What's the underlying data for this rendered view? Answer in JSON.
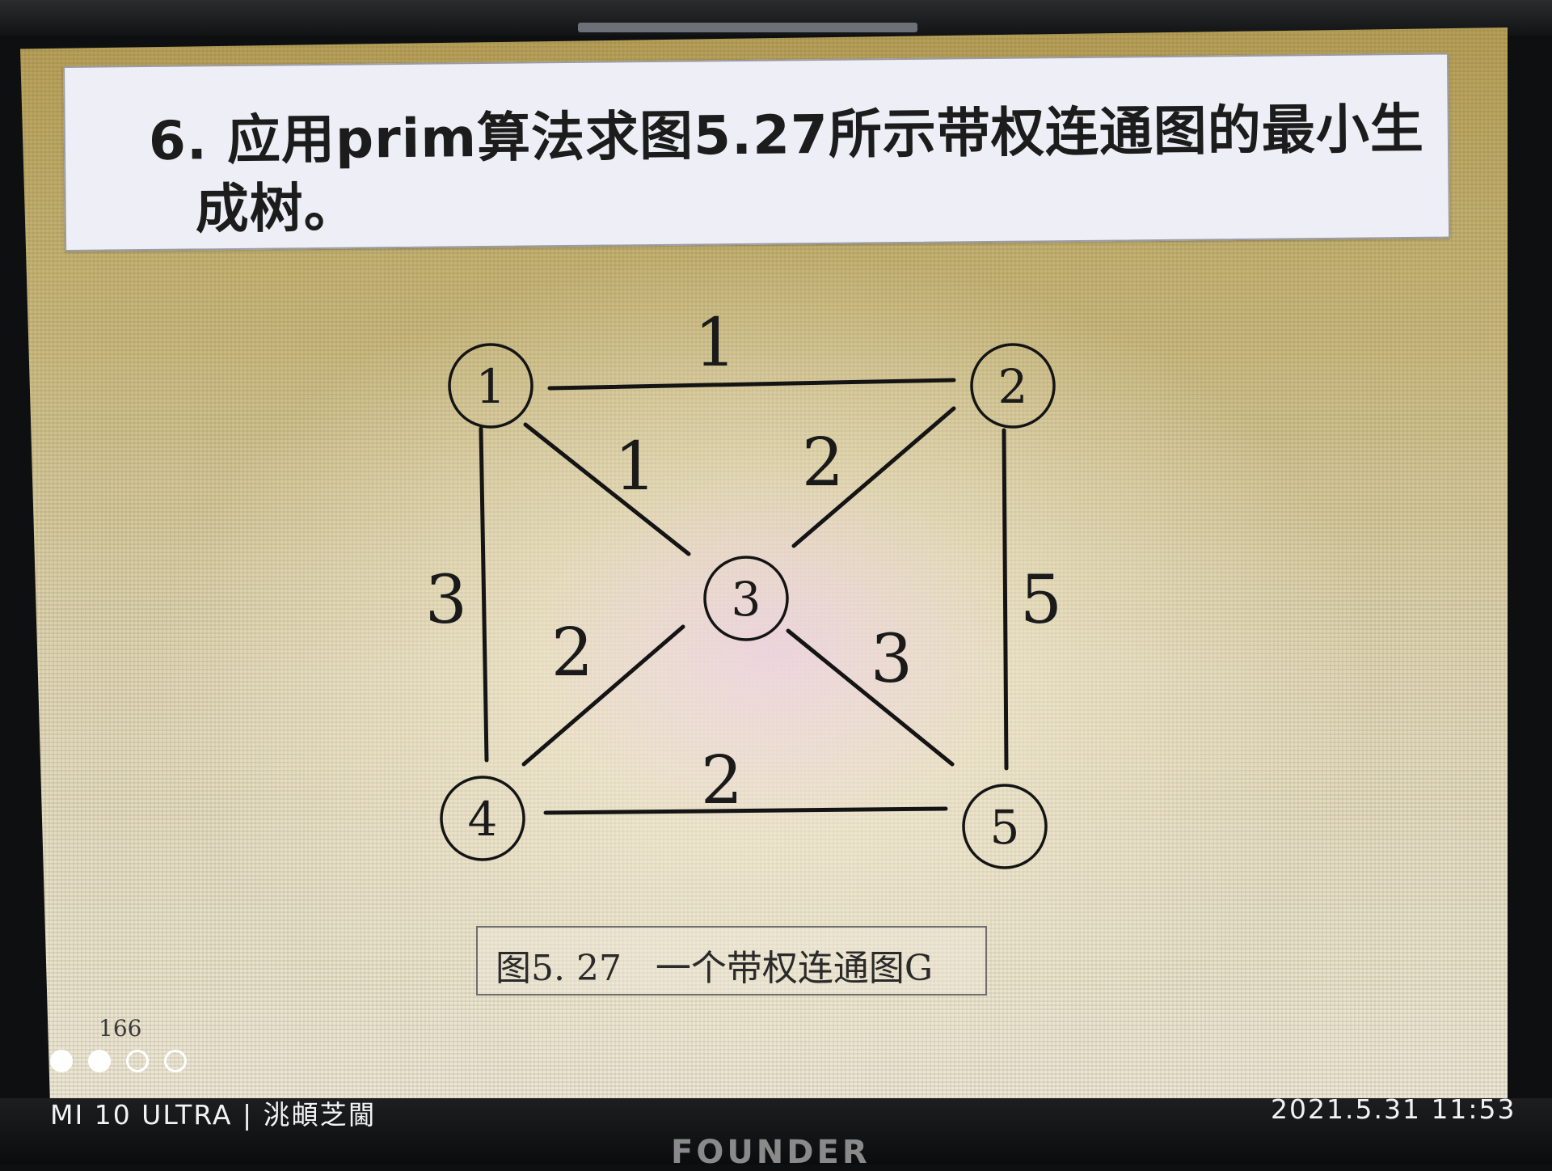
{
  "slide": {
    "title_line_1": "6. 应用prim算法求图5.27所示带权连通图的最小生",
    "title_line_2": "成树。",
    "caption": "图5. 27   一个带权连通图G",
    "page_number": "166"
  },
  "graph": {
    "nodes": [
      {
        "id": "1",
        "label": "①"
      },
      {
        "id": "2",
        "label": "②"
      },
      {
        "id": "3",
        "label": "③"
      },
      {
        "id": "4",
        "label": "④"
      },
      {
        "id": "5",
        "label": "⑤"
      }
    ],
    "edges": [
      {
        "from": "1",
        "to": "2",
        "weight": "1"
      },
      {
        "from": "1",
        "to": "3",
        "weight": "1"
      },
      {
        "from": "2",
        "to": "3",
        "weight": "2"
      },
      {
        "from": "1",
        "to": "4",
        "weight": "3"
      },
      {
        "from": "2",
        "to": "5",
        "weight": "5"
      },
      {
        "from": "3",
        "to": "4",
        "weight": "2"
      },
      {
        "from": "3",
        "to": "5",
        "weight": "3"
      },
      {
        "from": "4",
        "to": "5",
        "weight": "2"
      }
    ]
  },
  "camera_overlay": {
    "watermark_left": "MI 10 ULTRA | 洮頔芝閫",
    "watermark_right": "2021.5.31 11:53",
    "dots": [
      true,
      true,
      false,
      false
    ]
  },
  "monitor": {
    "brand": "FOUNDER"
  }
}
